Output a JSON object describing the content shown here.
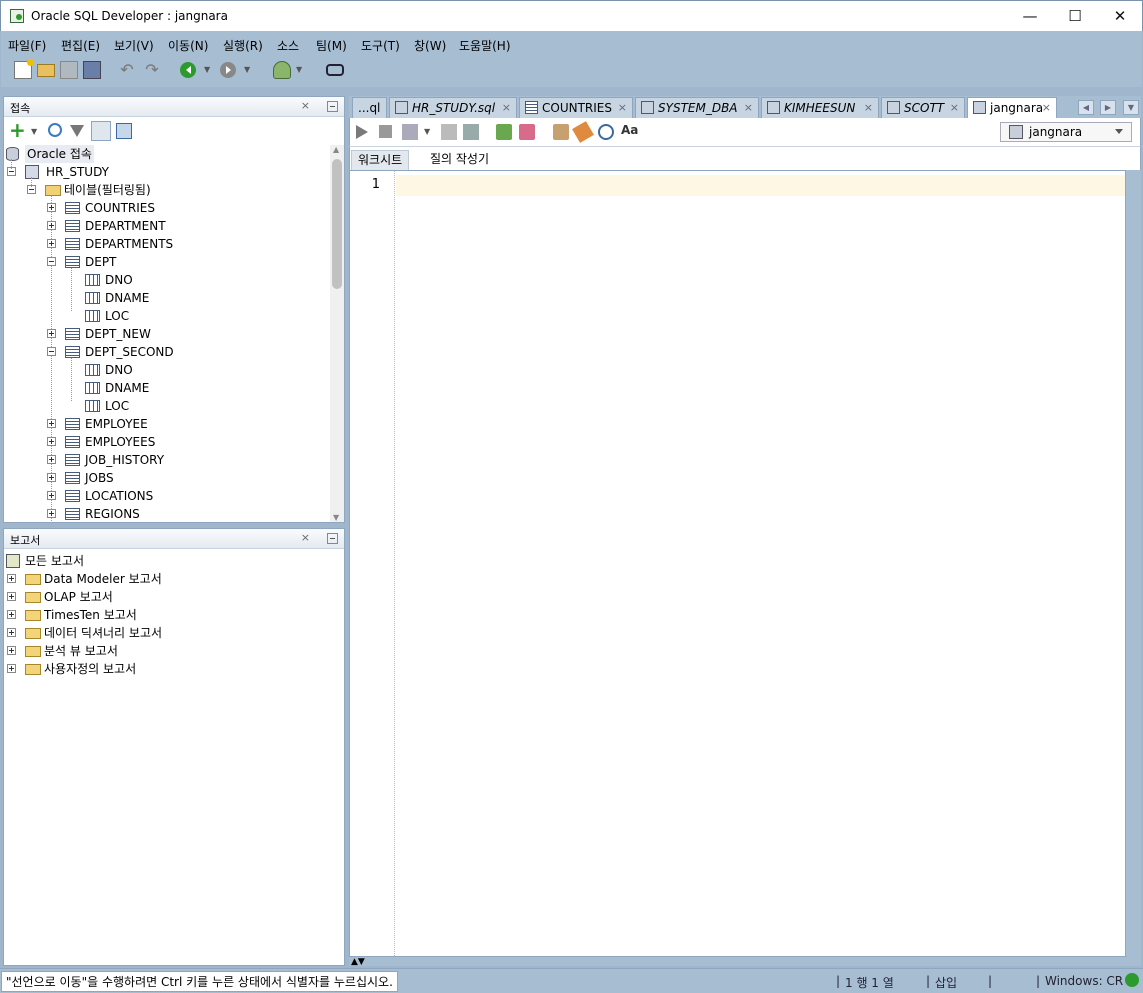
{
  "window": {
    "title": "Oracle SQL Developer : jangnara",
    "minimize_glyph": "—",
    "maximize_glyph": "☐",
    "close_glyph": "✕"
  },
  "menu": [
    "파일(F)",
    "편집(E)",
    "보기(V)",
    "이동(N)",
    "실행(R)",
    "소스",
    "팀(M)",
    "도구(T)",
    "창(W)",
    "도움말(H)"
  ],
  "toolbar_icons": [
    "new-file-icon",
    "open-folder-icon",
    "save-icon",
    "save-all-icon",
    "undo-icon",
    "redo-icon",
    "back-icon",
    "forward-icon",
    "sql-connection-icon",
    "binoculars-icon"
  ],
  "connections_panel": {
    "title": "접속",
    "close": "×",
    "tools": [
      "add-connection-icon",
      "refresh-icon",
      "filter-icon",
      "schema-browser-icon",
      "tns-icon"
    ],
    "root": "Oracle 접속",
    "connection": "HR_STUDY",
    "tables_folder": "테이블(필터링됨)",
    "tables": [
      {
        "name": "COUNTRIES",
        "expanded": false,
        "columns": []
      },
      {
        "name": "DEPARTMENT",
        "expanded": false,
        "columns": []
      },
      {
        "name": "DEPARTMENTS",
        "expanded": false,
        "columns": []
      },
      {
        "name": "DEPT",
        "expanded": true,
        "columns": [
          "DNO",
          "DNAME",
          "LOC"
        ]
      },
      {
        "name": "DEPT_NEW",
        "expanded": false,
        "columns": []
      },
      {
        "name": "DEPT_SECOND",
        "expanded": true,
        "columns": [
          "DNO",
          "DNAME",
          "LOC"
        ]
      },
      {
        "name": "EMPLOYEE",
        "expanded": false,
        "columns": []
      },
      {
        "name": "EMPLOYEES",
        "expanded": false,
        "columns": []
      },
      {
        "name": "JOB_HISTORY",
        "expanded": false,
        "columns": []
      },
      {
        "name": "JOBS",
        "expanded": false,
        "columns": []
      },
      {
        "name": "LOCATIONS",
        "expanded": false,
        "columns": []
      },
      {
        "name": "REGIONS",
        "expanded": false,
        "columns": []
      }
    ]
  },
  "reports_panel": {
    "title": "보고서",
    "close": "×",
    "root": "모든 보고서",
    "items": [
      "Data Modeler 보고서",
      "OLAP 보고서",
      "TimesTen 보고서",
      "데이터 딕셔너리 보고서",
      "분석 뷰 보고서",
      "사용자정의 보고서"
    ]
  },
  "editor": {
    "tabs": [
      {
        "label": "...ql",
        "icon": "",
        "italic": false,
        "active": false
      },
      {
        "label": "HR_STUDY.sql",
        "icon": "sql-file-icon",
        "italic": true,
        "active": false
      },
      {
        "label": "COUNTRIES",
        "icon": "table-icon",
        "italic": false,
        "active": false
      },
      {
        "label": "SYSTEM_DBA",
        "icon": "sql-worksheet-icon",
        "italic": true,
        "active": false
      },
      {
        "label": "KIMHEESUN",
        "icon": "sql-worksheet-icon",
        "italic": true,
        "active": false
      },
      {
        "label": "SCOTT",
        "icon": "sql-worksheet-icon",
        "italic": true,
        "active": false
      },
      {
        "label": "jangnara",
        "icon": "sql-worksheet-icon",
        "italic": false,
        "active": true
      }
    ],
    "tab_close": "×",
    "connection_selector": "jangnara",
    "subtabs": [
      "워크시트",
      "질의 작성기"
    ],
    "line_number": "1"
  },
  "status": {
    "message": "\"선언으로 이동\"을 수행하려면 Ctrl 키를 누른 상태에서 식별자를 누르십시오.",
    "position": "1 행 1 열",
    "mode": "삽입",
    "line_ending": "Windows: CR"
  }
}
